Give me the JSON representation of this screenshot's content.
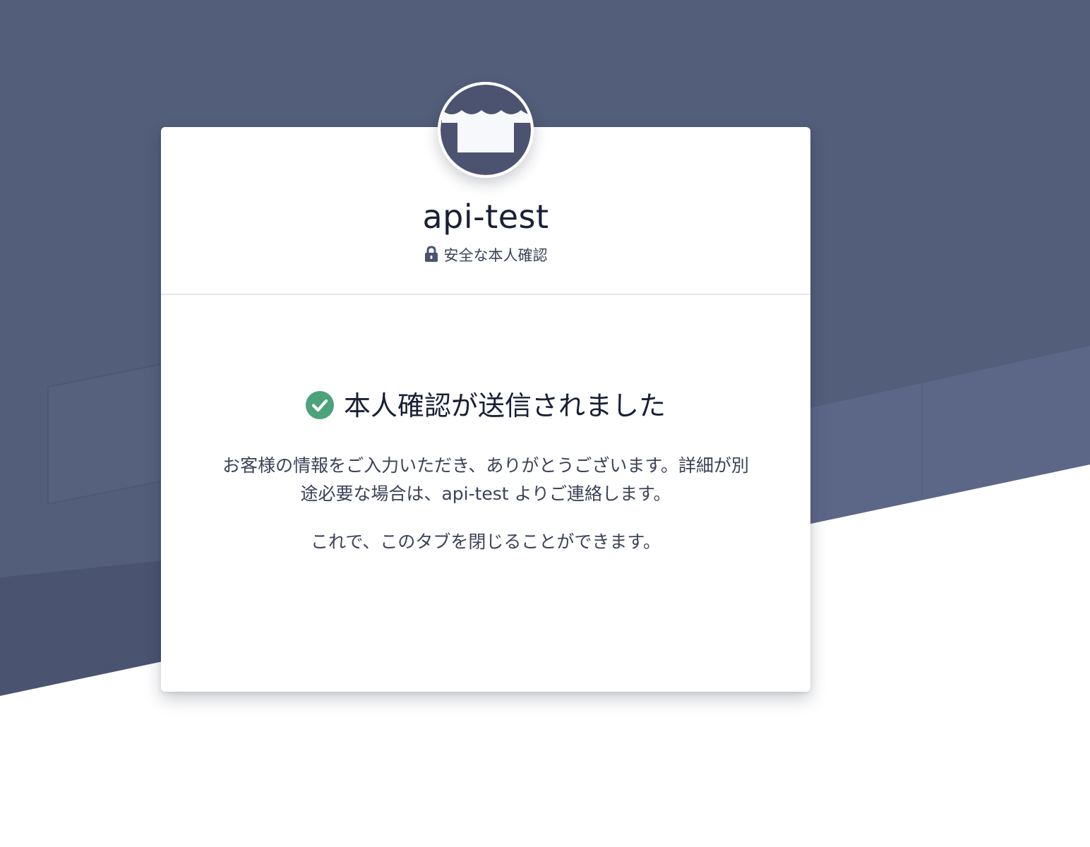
{
  "colors": {
    "background_dark": "#535e7a",
    "background_mid": "#5c6788",
    "background_band": "#4a5470",
    "accent_success": "#4ca27a",
    "text_primary": "#1a1f36",
    "text_secondary": "#3c4257"
  },
  "header": {
    "avatar_icon": "storefront-icon",
    "merchant_name": "api-test",
    "secure_icon": "lock-icon",
    "secure_label": "安全な本人確認"
  },
  "body": {
    "status_icon": "check-circle-icon",
    "title": "本人確認が送信されました",
    "message_line1": "お客様の情報をご入力いただき、ありがとうございます。詳細が別",
    "message_line2": "途必要な場合は、api-test よりご連絡します。",
    "closing": "これで、このタブを閉じることができます。"
  }
}
